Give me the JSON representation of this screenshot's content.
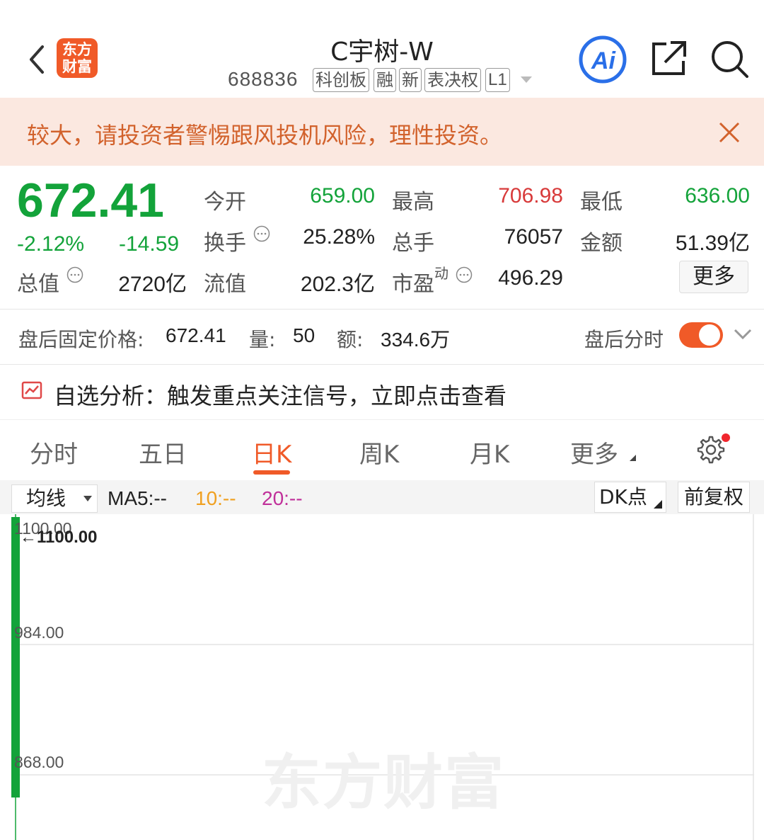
{
  "header": {
    "logo_text": "东方财富",
    "title": "C宇树-W",
    "code": "688836",
    "tags": [
      "科创板",
      "融",
      "新",
      "表决权",
      "L1"
    ],
    "icons": [
      "back-arrow-icon",
      "ai-icon",
      "share-icon",
      "search-icon"
    ]
  },
  "banner": {
    "text": "较大，请投资者警惕跟风投机风险，理性投资。"
  },
  "quote": {
    "price": "672.41",
    "change_pct": "-2.12%",
    "change_amt": "-14.59",
    "stats": {
      "open_label": "今开",
      "open": "659.00",
      "high_label": "最高",
      "high": "706.98",
      "low_label": "最低",
      "low": "636.00",
      "turnover_label": "换手",
      "turnover": "25.28%",
      "volume_label": "总手",
      "volume": "76057",
      "amount_label": "金额",
      "amount": "51.39亿",
      "mktcap_label": "总值",
      "mktcap": "2720亿",
      "float_label": "流值",
      "float": "202.3亿",
      "pe_label": "市盈",
      "pe_sup": "动",
      "pe": "496.29"
    },
    "more_label": "更多",
    "colors": {
      "up": "#d83a3a",
      "down": "#13a33a",
      "accent": "#f05a28"
    }
  },
  "after_hours": {
    "label": "盘后固定价格:",
    "price": "672.41",
    "vol_label": "量:",
    "vol": "50",
    "amt_label": "额:",
    "amt": "334.6万",
    "switch_label": "盘后分时",
    "switch_on": true
  },
  "analysis": {
    "text": "自选分析：触发重点关注信号，立即点击查看"
  },
  "tabs": {
    "items": [
      "分时",
      "五日",
      "日K",
      "周K",
      "月K",
      "更多"
    ],
    "active": "日K"
  },
  "ma_bar": {
    "select": "均线",
    "ma5": "MA5:--",
    "ma10": "10:--",
    "ma20": "20:--",
    "dk": "DK点",
    "adjust": "前复权",
    "ma10_color": "#f0a020",
    "ma20_color": "#c0309a"
  },
  "chart": {
    "watermark": "东方财富",
    "max_label": "←1100.00",
    "y_ticks": [
      "1100.00",
      "984.00",
      "868.00"
    ],
    "candle_color": "#13a33a"
  }
}
